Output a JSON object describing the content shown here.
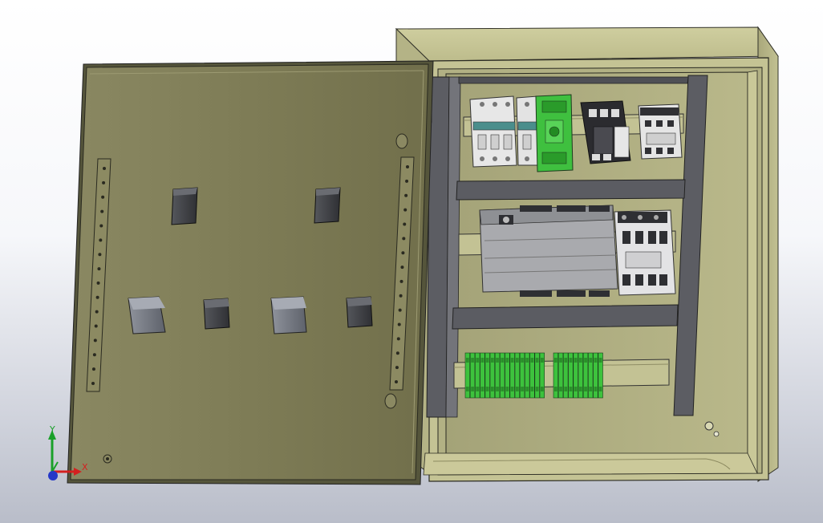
{
  "triad": {
    "x_label": "X",
    "y_label": "Y",
    "x_color": "#d42020",
    "y_color": "#1aa02a",
    "z_color": "#2438c8"
  },
  "model": {
    "enclosure_color": "#c9c89a",
    "door_color": "#7d7b55",
    "mounting_frame_color": "#5b5c62",
    "din_rail_color": "#c1c093",
    "terminal_block_color": "#3dc23d",
    "breaker_color": "#e6e6e6",
    "contactor_color": "#2a2a2e"
  }
}
